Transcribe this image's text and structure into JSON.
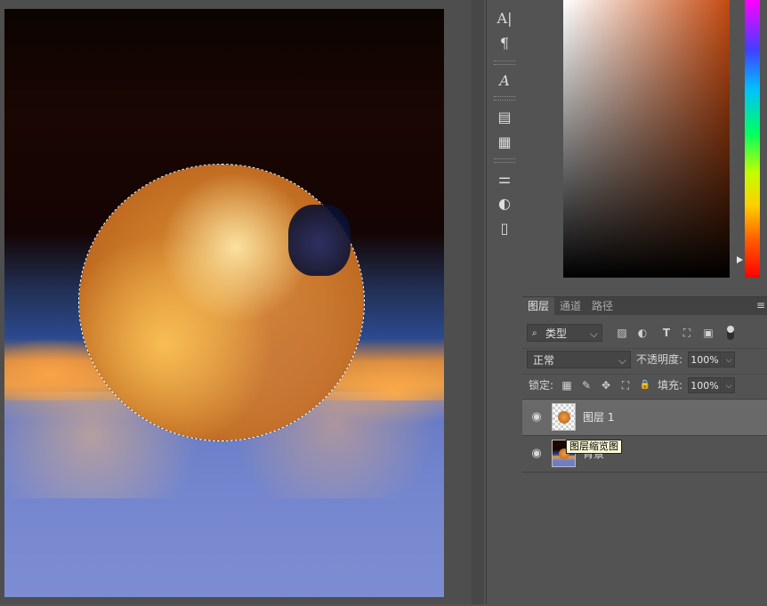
{
  "tools": [
    {
      "name": "character-icon",
      "glyph": "A|"
    },
    {
      "name": "paragraph-icon",
      "glyph": "¶"
    },
    {
      "name": "glyphs-icon",
      "glyph": "𝐴"
    },
    {
      "name": "character-styles-icon",
      "glyph": "▤"
    },
    {
      "name": "paragraph-styles-icon",
      "glyph": "▦"
    },
    {
      "name": "adjustments-icon",
      "glyph": "⚌"
    },
    {
      "name": "adjustment-circle-icon",
      "glyph": "◐"
    },
    {
      "name": "libraries-icon",
      "glyph": "▯"
    }
  ],
  "layers_panel": {
    "tabs": [
      "图层",
      "通道",
      "路径"
    ],
    "menu_glyph": "≡",
    "filter": {
      "label": "类型",
      "search_glyph": "🔍"
    },
    "filter_icons": [
      "▨",
      "◐",
      "T",
      "⛶",
      "▣"
    ],
    "blend_mode": "正常",
    "opacity_label": "不透明度:",
    "opacity_value": "100%",
    "lock_label": "锁定:",
    "lock_icons": [
      "▦",
      "✎",
      "✥",
      "⛶",
      "🔒"
    ],
    "fill_label": "填充:",
    "fill_value": "100%",
    "layers": [
      {
        "name": "图层 1",
        "visible_glyph": "👁",
        "selected": true
      },
      {
        "name": "背景",
        "visible_glyph": "👁",
        "selected": false
      }
    ],
    "tooltip": "图层缩览图"
  },
  "colors": {
    "selected_layer_bg": "#696969",
    "panel_bg": "#535353"
  }
}
